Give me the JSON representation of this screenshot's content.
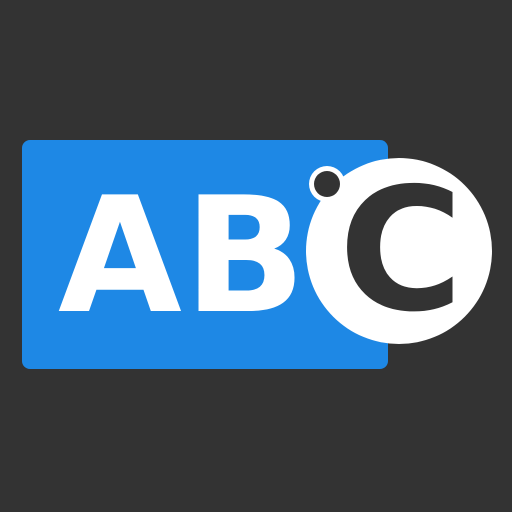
{
  "logo": {
    "letters": [
      "A",
      "B",
      "C"
    ],
    "colors": {
      "background": "#333333",
      "box": "#1E88E5",
      "letter_on_box": "#ffffff",
      "circle": "#ffffff",
      "letter_on_circle": "#333333"
    }
  }
}
